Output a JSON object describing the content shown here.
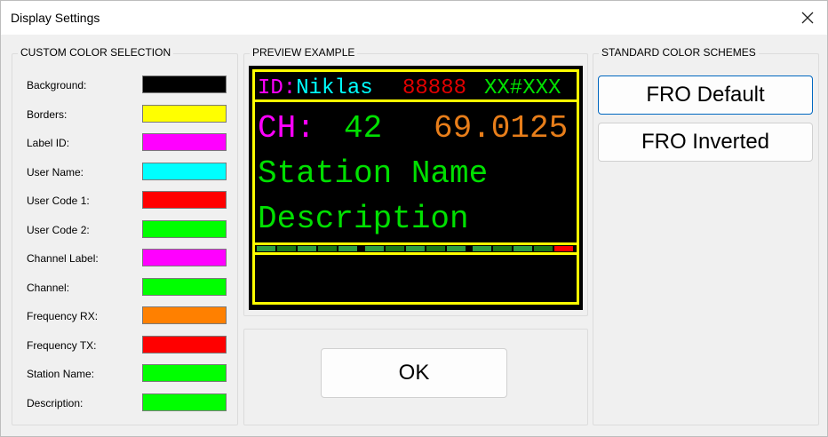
{
  "window": {
    "title": "Display Settings"
  },
  "custom": {
    "legend": "CUSTOM COLOR SELECTION",
    "rows": [
      {
        "label": "Background:",
        "color": "#000000"
      },
      {
        "label": "Borders:",
        "color": "#ffff00"
      },
      {
        "label": "Label ID:",
        "color": "#ff00ff"
      },
      {
        "label": "User Name:",
        "color": "#00ffff"
      },
      {
        "label": "User Code 1:",
        "color": "#ff0000"
      },
      {
        "label": "User Code 2:",
        "color": "#00ff00"
      },
      {
        "label": "Channel Label:",
        "color": "#ff00ff"
      },
      {
        "label": "Channel:",
        "color": "#00ff00"
      },
      {
        "label": "Frequency RX:",
        "color": "#ff8000"
      },
      {
        "label": "Frequency TX:",
        "color": "#ff0000"
      },
      {
        "label": "Station Name:",
        "color": "#00ff00"
      },
      {
        "label": "Description:",
        "color": "#00ff00"
      }
    ]
  },
  "preview": {
    "legend": "PREVIEW EXAMPLE",
    "label_id": "ID:",
    "user_name": "Niklas",
    "user_code_1": "88888",
    "user_code_2": "XX#XXX",
    "channel_label": "CH:",
    "channel": "42",
    "frequency": "69.0125",
    "station_name": "Station Name",
    "description": "Description",
    "colors": {
      "border": "#ffff00",
      "label_id": "#ff00ff",
      "user_name": "#00ffff",
      "user_code_1": "#e00000",
      "user_code_2": "#00e000",
      "channel_label": "#ff00ff",
      "channel": "#00e000",
      "frequency": "#e87e1a",
      "station": "#00e000",
      "description": "#00e000",
      "meter_on": "#2ea043",
      "meter_dim": "#1a7a1a",
      "meter_peak": "#ff0000"
    }
  },
  "actions": {
    "ok_label": "OK"
  },
  "schemes": {
    "legend": "STANDARD COLOR SCHEMES",
    "default_label": "FRO Default",
    "inverted_label": "FRO Inverted"
  }
}
